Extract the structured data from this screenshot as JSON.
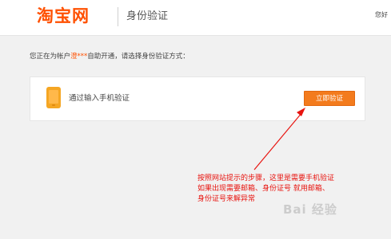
{
  "header": {
    "logo_text": "淘宝网",
    "page_title": "身份验证",
    "topright_text": "您好"
  },
  "prompt": {
    "prefix": "您正在为帐户",
    "account": "澄***",
    "suffix": "自助开通，请选择身份验证方式："
  },
  "method": {
    "icon": "mobile-phone-icon",
    "label": "通过输入手机验证",
    "button_label": "立即验证"
  },
  "annotation": {
    "line1": "按照网站提示的步骤，这里是需要手机验证",
    "line2": "如果出现需要邮箱、身份证号 就用邮箱、",
    "line3": "身份证号来解异常"
  },
  "watermark": "Bai 经验",
  "colors": {
    "brand_orange": "#ff5000",
    "button_orange": "#f37b1d",
    "annotation_red": "#e8140f",
    "background": "#f1f1f1"
  }
}
